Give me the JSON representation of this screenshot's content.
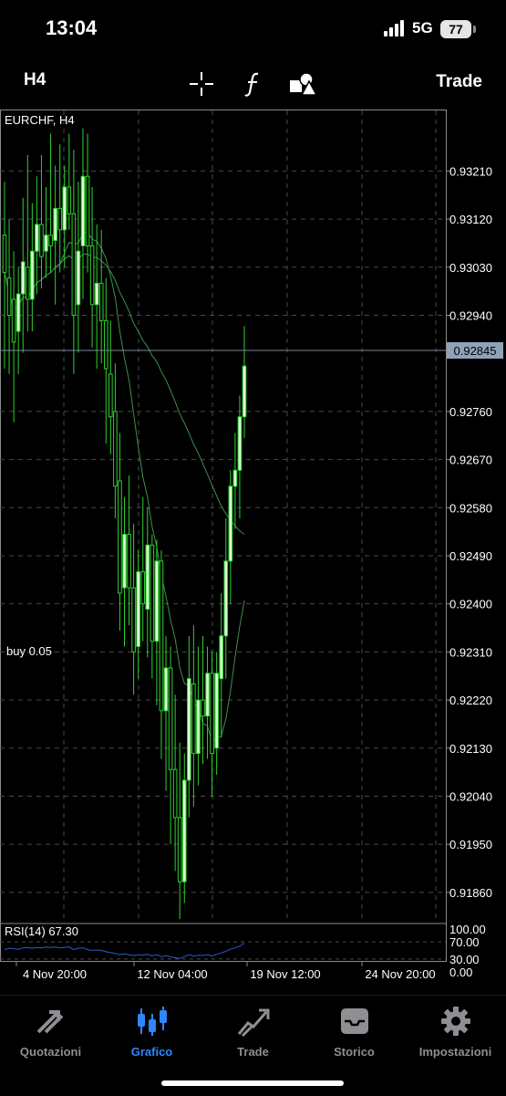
{
  "status_bar": {
    "time": "13:04",
    "network": "5G",
    "battery": "77"
  },
  "toolbar": {
    "timeframe": "H4",
    "tools": [
      "crosshair-icon",
      "indicators-icon",
      "objects-icon"
    ],
    "trade_label": "Trade"
  },
  "chart": {
    "symbol_label": "EURCHF, H4",
    "current_price": "0.92845",
    "order_label": "buy 0.05",
    "price_labels": [
      "0.93210",
      "0.93120",
      "0.93030",
      "0.92940",
      "0.92760",
      "0.92670",
      "0.92580",
      "0.92490",
      "0.92400",
      "0.92310",
      "0.92220",
      "0.92130",
      "0.92040",
      "0.91950",
      "0.91860"
    ],
    "time_labels": [
      "4 Nov 20:00",
      "12 Nov 04:00",
      "19 Nov 12:00",
      "24 Nov 20:00"
    ],
    "rsi_label": "RSI(14) 67.30",
    "rsi_levels": [
      "100.00",
      "70.00",
      "30.00",
      "0.00"
    ],
    "colors": {
      "candle": "#2fd12f",
      "ma": "#3e8f4c",
      "rsi": "#2a5cc9",
      "grid": "#4a4a4a"
    }
  },
  "chart_data": {
    "type": "candlestick",
    "symbol": "EURCHF",
    "timeframe": "H4",
    "ylim": [
      0.918,
      0.9332
    ],
    "current_price": 0.92845,
    "candles": [
      {
        "o": 0.9309,
        "h": 0.9319,
        "l": 0.9284,
        "c": 0.9302
      },
      {
        "o": 0.9301,
        "h": 0.9312,
        "l": 0.9283,
        "c": 0.9294
      },
      {
        "o": 0.9297,
        "h": 0.9306,
        "l": 0.9274,
        "c": 0.9289
      },
      {
        "o": 0.9291,
        "h": 0.9303,
        "l": 0.9283,
        "c": 0.9298
      },
      {
        "o": 0.9298,
        "h": 0.9316,
        "l": 0.9287,
        "c": 0.9304
      },
      {
        "o": 0.9303,
        "h": 0.9324,
        "l": 0.9291,
        "c": 0.9297
      },
      {
        "o": 0.9297,
        "h": 0.9315,
        "l": 0.9291,
        "c": 0.9306
      },
      {
        "o": 0.9306,
        "h": 0.932,
        "l": 0.9298,
        "c": 0.9311
      },
      {
        "o": 0.9311,
        "h": 0.9324,
        "l": 0.9299,
        "c": 0.9305
      },
      {
        "o": 0.9306,
        "h": 0.9318,
        "l": 0.9301,
        "c": 0.9309
      },
      {
        "o": 0.9309,
        "h": 0.9328,
        "l": 0.9302,
        "c": 0.9307
      },
      {
        "o": 0.9308,
        "h": 0.9322,
        "l": 0.9296,
        "c": 0.9314
      },
      {
        "o": 0.9314,
        "h": 0.9326,
        "l": 0.9302,
        "c": 0.931
      },
      {
        "o": 0.931,
        "h": 0.9322,
        "l": 0.9303,
        "c": 0.9318
      },
      {
        "o": 0.9318,
        "h": 0.9328,
        "l": 0.931,
        "c": 0.9313
      },
      {
        "o": 0.9313,
        "h": 0.9325,
        "l": 0.9283,
        "c": 0.9294
      },
      {
        "o": 0.9296,
        "h": 0.9319,
        "l": 0.9287,
        "c": 0.9306
      },
      {
        "o": 0.9307,
        "h": 0.9329,
        "l": 0.9297,
        "c": 0.932
      },
      {
        "o": 0.932,
        "h": 0.9328,
        "l": 0.9302,
        "c": 0.9307
      },
      {
        "o": 0.9307,
        "h": 0.9318,
        "l": 0.9288,
        "c": 0.9296
      },
      {
        "o": 0.9296,
        "h": 0.9311,
        "l": 0.9284,
        "c": 0.93
      },
      {
        "o": 0.93,
        "h": 0.931,
        "l": 0.9285,
        "c": 0.9293
      },
      {
        "o": 0.9293,
        "h": 0.9301,
        "l": 0.927,
        "c": 0.9284
      },
      {
        "o": 0.9283,
        "h": 0.9293,
        "l": 0.9268,
        "c": 0.9275
      },
      {
        "o": 0.9276,
        "h": 0.9285,
        "l": 0.9256,
        "c": 0.9262
      },
      {
        "o": 0.9263,
        "h": 0.9272,
        "l": 0.9235,
        "c": 0.9242
      },
      {
        "o": 0.9243,
        "h": 0.926,
        "l": 0.9232,
        "c": 0.9253
      },
      {
        "o": 0.9253,
        "h": 0.9264,
        "l": 0.9236,
        "c": 0.9243
      },
      {
        "o": 0.9243,
        "h": 0.9255,
        "l": 0.9223,
        "c": 0.9231
      },
      {
        "o": 0.9232,
        "h": 0.925,
        "l": 0.9226,
        "c": 0.9246
      },
      {
        "o": 0.9246,
        "h": 0.926,
        "l": 0.9233,
        "c": 0.924
      },
      {
        "o": 0.9239,
        "h": 0.9258,
        "l": 0.923,
        "c": 0.9251
      },
      {
        "o": 0.9251,
        "h": 0.9253,
        "l": 0.9226,
        "c": 0.9233
      },
      {
        "o": 0.9233,
        "h": 0.9252,
        "l": 0.9221,
        "c": 0.9248
      },
      {
        "o": 0.9248,
        "h": 0.925,
        "l": 0.9211,
        "c": 0.922
      },
      {
        "o": 0.922,
        "h": 0.9234,
        "l": 0.9205,
        "c": 0.9228
      },
      {
        "o": 0.9228,
        "h": 0.9232,
        "l": 0.9195,
        "c": 0.9209
      },
      {
        "o": 0.9209,
        "h": 0.9223,
        "l": 0.919,
        "c": 0.92
      },
      {
        "o": 0.92,
        "h": 0.9214,
        "l": 0.9181,
        "c": 0.9188
      },
      {
        "o": 0.9188,
        "h": 0.9212,
        "l": 0.9184,
        "c": 0.9207
      },
      {
        "o": 0.9207,
        "h": 0.9234,
        "l": 0.92,
        "c": 0.9226
      },
      {
        "o": 0.9225,
        "h": 0.9236,
        "l": 0.9202,
        "c": 0.9212
      },
      {
        "o": 0.9212,
        "h": 0.9232,
        "l": 0.9206,
        "c": 0.9222
      },
      {
        "o": 0.9222,
        "h": 0.9234,
        "l": 0.921,
        "c": 0.9219
      },
      {
        "o": 0.9219,
        "h": 0.9232,
        "l": 0.9211,
        "c": 0.9227
      },
      {
        "o": 0.9227,
        "h": 0.9231,
        "l": 0.9204,
        "c": 0.9212
      },
      {
        "o": 0.9213,
        "h": 0.9231,
        "l": 0.9208,
        "c": 0.9227
      },
      {
        "o": 0.9226,
        "h": 0.9242,
        "l": 0.9215,
        "c": 0.9234
      },
      {
        "o": 0.9234,
        "h": 0.9256,
        "l": 0.9226,
        "c": 0.9248
      },
      {
        "o": 0.9248,
        "h": 0.9265,
        "l": 0.924,
        "c": 0.9262
      },
      {
        "o": 0.9262,
        "h": 0.9272,
        "l": 0.9254,
        "c": 0.9265
      },
      {
        "o": 0.9265,
        "h": 0.9279,
        "l": 0.9256,
        "c": 0.9275
      },
      {
        "o": 0.9275,
        "h": 0.9292,
        "l": 0.9271,
        "c": 0.92845
      }
    ],
    "rsi": {
      "name": "RSI(14)",
      "last": 67.3,
      "levels": [
        100,
        70,
        30,
        0
      ],
      "values": [
        52,
        55,
        54,
        53,
        56,
        57,
        55,
        57,
        56,
        58,
        57,
        58,
        56,
        57,
        58,
        52,
        55,
        56,
        52,
        50,
        51,
        50,
        47,
        45,
        43,
        40,
        42,
        40,
        38,
        40,
        39,
        41,
        37,
        40,
        35,
        38,
        35,
        33,
        31,
        36,
        40,
        37,
        39,
        38,
        40,
        37,
        41,
        44,
        48,
        53,
        56,
        60,
        67.3
      ]
    }
  }
}
